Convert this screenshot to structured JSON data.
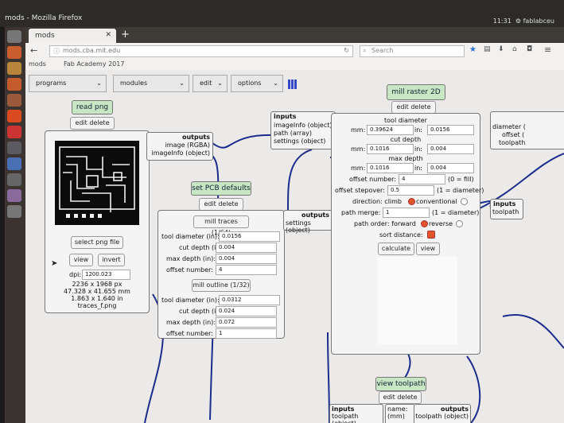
{
  "os": {
    "window_title": "mods - Mozilla Firefox",
    "clock": "11:31",
    "user": "fablabceu"
  },
  "browser": {
    "tab_label": "mods",
    "url": "mods.cba.mit.edu",
    "search_placeholder": "Search",
    "bookmarks": [
      "mods",
      "Fab Academy 2017"
    ]
  },
  "toolbar": {
    "programs": "programs",
    "modules": "modules",
    "edit": "edit",
    "options": "options"
  },
  "read_png": {
    "title": "read png",
    "edit_delete": "edit delete",
    "outputs_header": "outputs",
    "outputs": [
      "image (RGBA)",
      "imageInfo (object)"
    ],
    "select_button": "select png file",
    "view_button": "view",
    "invert_button": "invert",
    "dpi_label": "dpi:",
    "dpi_value": "1200.023",
    "info": [
      "2236 x 1968 px",
      "47.328 x 41.655 mm",
      "1.863 x 1.640 in",
      "traces_f.png"
    ]
  },
  "pcb": {
    "title": "set PCB defaults",
    "edit_delete": "edit delete",
    "mill_traces": "mill traces (1/64)",
    "mill_outline": "mill outline (1/32)",
    "traces": [
      {
        "label": "tool diameter (in):",
        "value": "0.0156"
      },
      {
        "label": "cut depth (in):",
        "value": "0.004"
      },
      {
        "label": "max depth (in):",
        "value": "0.004"
      },
      {
        "label": "offset number:",
        "value": "4"
      }
    ],
    "outline": [
      {
        "label": "tool diameter (in):",
        "value": "0.0312"
      },
      {
        "label": "cut depth (in):",
        "value": "0.024"
      },
      {
        "label": "max depth (in):",
        "value": "0.072"
      },
      {
        "label": "offset number:",
        "value": "1"
      }
    ],
    "outputs_header": "outputs",
    "outputs": [
      "settings (object)"
    ]
  },
  "mill_inputs": {
    "header": "inputs",
    "items": [
      "imageInfo (object)",
      "path (array)",
      "settings (object)"
    ]
  },
  "mill": {
    "title": "mill raster 2D",
    "edit_delete": "edit delete",
    "tool_diameter": {
      "title": "tool diameter",
      "mm": "0.39624",
      "in": "0.0156"
    },
    "cut_depth": {
      "title": "cut depth",
      "mm": "0.1016",
      "in": "0.004"
    },
    "max_depth": {
      "title": "max depth",
      "mm": "0.1016",
      "in": "0.004"
    },
    "mm_label": "mm:",
    "in_label": "in:",
    "offset_number_label": "offset number:",
    "offset_number_value": "4",
    "offset_number_hint": "(0 = fill)",
    "offset_stepover_label": "offset stepover:",
    "offset_stepover_value": "0.5",
    "offset_stepover_hint": "(1 = diameter)",
    "direction_label": "direction: climb",
    "direction_alt": "conventional",
    "path_merge_label": "path merge:",
    "path_merge_value": "1",
    "path_merge_hint": "(1 = diameter)",
    "path_order_label": "path order: forward",
    "path_order_alt": "reverse",
    "sort_label": "sort distance:",
    "calculate": "calculate",
    "view": "view"
  },
  "right_partial": {
    "outputs": [
      "diameter (",
      "offset (",
      "toolpath"
    ],
    "inputs_header": "inputs",
    "inputs": [
      "toolpath"
    ]
  },
  "view_toolpath": {
    "title": "view toolpath",
    "edit_delete": "edit delete"
  },
  "bottom": {
    "inputs": "inputs",
    "inputs_sub": "toolpath (object)",
    "name": "name:",
    "name_sub": "(mm)",
    "outputs": "outputs",
    "outputs_sub": "toolpath (object)"
  },
  "colors": {
    "wire": "#1c2c8c",
    "node_green": "#c9e6c4",
    "radio_on": "#e2552b"
  }
}
